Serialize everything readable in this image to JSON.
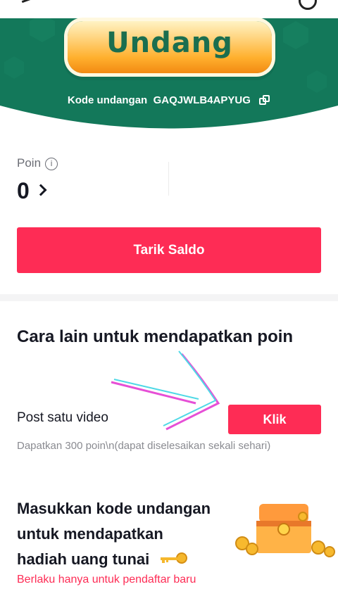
{
  "hero": {
    "invite_label": "Undang",
    "code_label": "Kode undangan",
    "code_value": "GAQJWLB4APYUG",
    "colors": {
      "green": "#13785a",
      "gold": "#ffb02e",
      "text_green": "#1b6e4f"
    }
  },
  "points": {
    "label": "Poin",
    "value": "0",
    "info_icon": "info-icon"
  },
  "withdraw": {
    "label": "Tarik Saldo"
  },
  "other_ways": {
    "title": "Cara lain untuk mendapatkan poin",
    "task": {
      "label": "Post satu video",
      "button": "Klik",
      "description": "Dapatkan 300 poin\\n(dapat diselesaikan sekali sehari)"
    }
  },
  "invite_code_section": {
    "title_line1": "Masukkan kode undangan",
    "title_line2": "untuk mendapatkan",
    "title_line3": "hadiah uang tunai",
    "note": "Berlaku hanya untuk pendaftar baru"
  },
  "colors": {
    "accent": "#fe2c55",
    "text": "#161823",
    "muted": "#8a8b91"
  }
}
